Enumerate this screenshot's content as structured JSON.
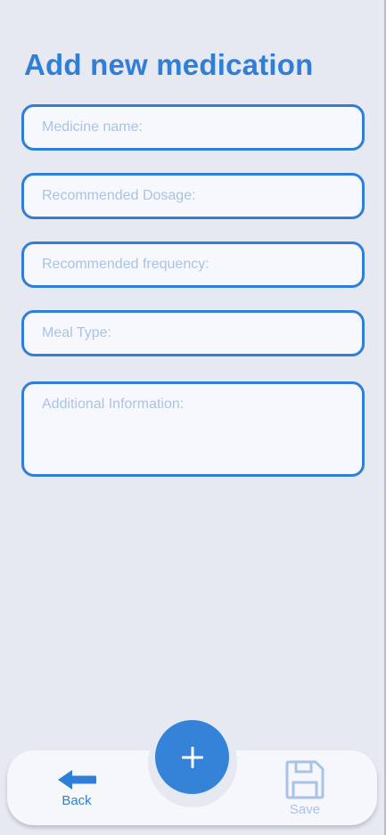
{
  "page": {
    "title": "Add new medication"
  },
  "form": {
    "fields": [
      {
        "placeholder": "Medicine name:",
        "value": ""
      },
      {
        "placeholder": "Recommended Dosage:",
        "value": ""
      },
      {
        "placeholder": "Recommended frequency:",
        "value": ""
      },
      {
        "placeholder": "Meal Type:",
        "value": ""
      },
      {
        "placeholder": "Additional Information:",
        "value": ""
      }
    ]
  },
  "bottom_nav": {
    "back_label": "Back",
    "save_label": "Save",
    "add_icon": "plus-icon",
    "back_icon": "arrow-left-icon",
    "save_icon": "floppy-disk-icon"
  },
  "colors": {
    "accent": "#2f7fd9",
    "placeholder": "#a9c3e6",
    "background": "#e6e9f2",
    "field_background": "#f6f8fb"
  }
}
